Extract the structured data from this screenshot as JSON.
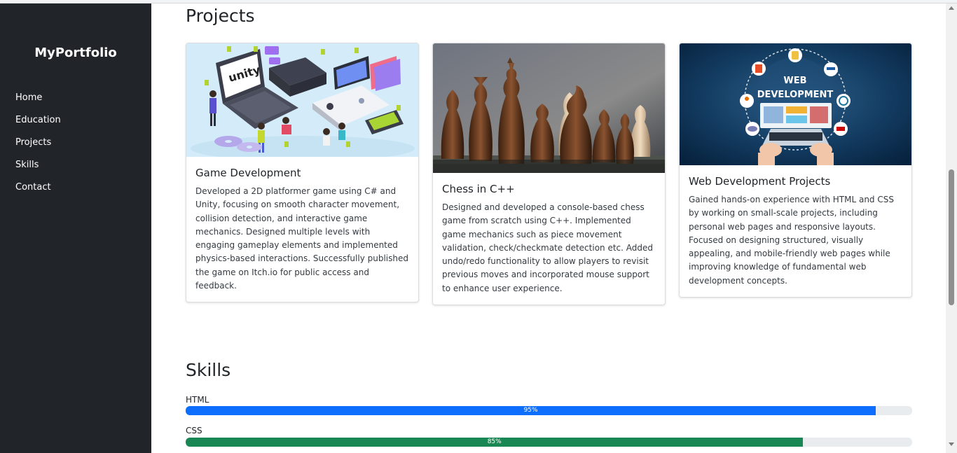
{
  "sidebar": {
    "brand": "MyPortfolio",
    "items": [
      {
        "label": "Home"
      },
      {
        "label": "Education"
      },
      {
        "label": "Projects"
      },
      {
        "label": "Skills"
      },
      {
        "label": "Contact"
      }
    ]
  },
  "projects": {
    "heading": "Projects",
    "cards": [
      {
        "title": "Game Development",
        "text": "Developed a 2D platformer game using C# and Unity, focusing on smooth character movement, collision detection, and interactive game mechanics. Designed multiple levels with engaging gameplay elements and implemented physics-based interactions. Successfully published the game on Itch.io for public access and feedback.",
        "image": "unity-game-illustration",
        "image_text": "unity"
      },
      {
        "title": "Chess in C++",
        "text": "Designed and developed a console-based chess game from scratch using C++. Implemented game mechanics such as piece movement validation, check/checkmate detection etc. Added undo/redo functionality to allow players to revisit previous moves and incorporated mouse support to enhance user experience.",
        "image": "chess-pieces-photo"
      },
      {
        "title": "Web Development Projects",
        "text": "Gained hands-on experience with HTML and CSS by working on small-scale projects, including personal web pages and responsive layouts. Focused on designing structured, visually appealing, and mobile-friendly web pages while improving knowledge of fundamental web development concepts.",
        "image": "web-development-illustration",
        "image_text_1": "WEB",
        "image_text_2": "DEVELOPMENT"
      }
    ]
  },
  "skills": {
    "heading": "Skills",
    "items": [
      {
        "label": "HTML",
        "percent_label": "95%",
        "percent": 95,
        "color": "#0d6efd"
      },
      {
        "label": "CSS",
        "percent_label": "85%",
        "percent": 85,
        "color": "#198754"
      }
    ]
  },
  "colors": {
    "sidebar_bg": "#212529",
    "accent_blue": "#0d6efd",
    "accent_green": "#198754"
  }
}
